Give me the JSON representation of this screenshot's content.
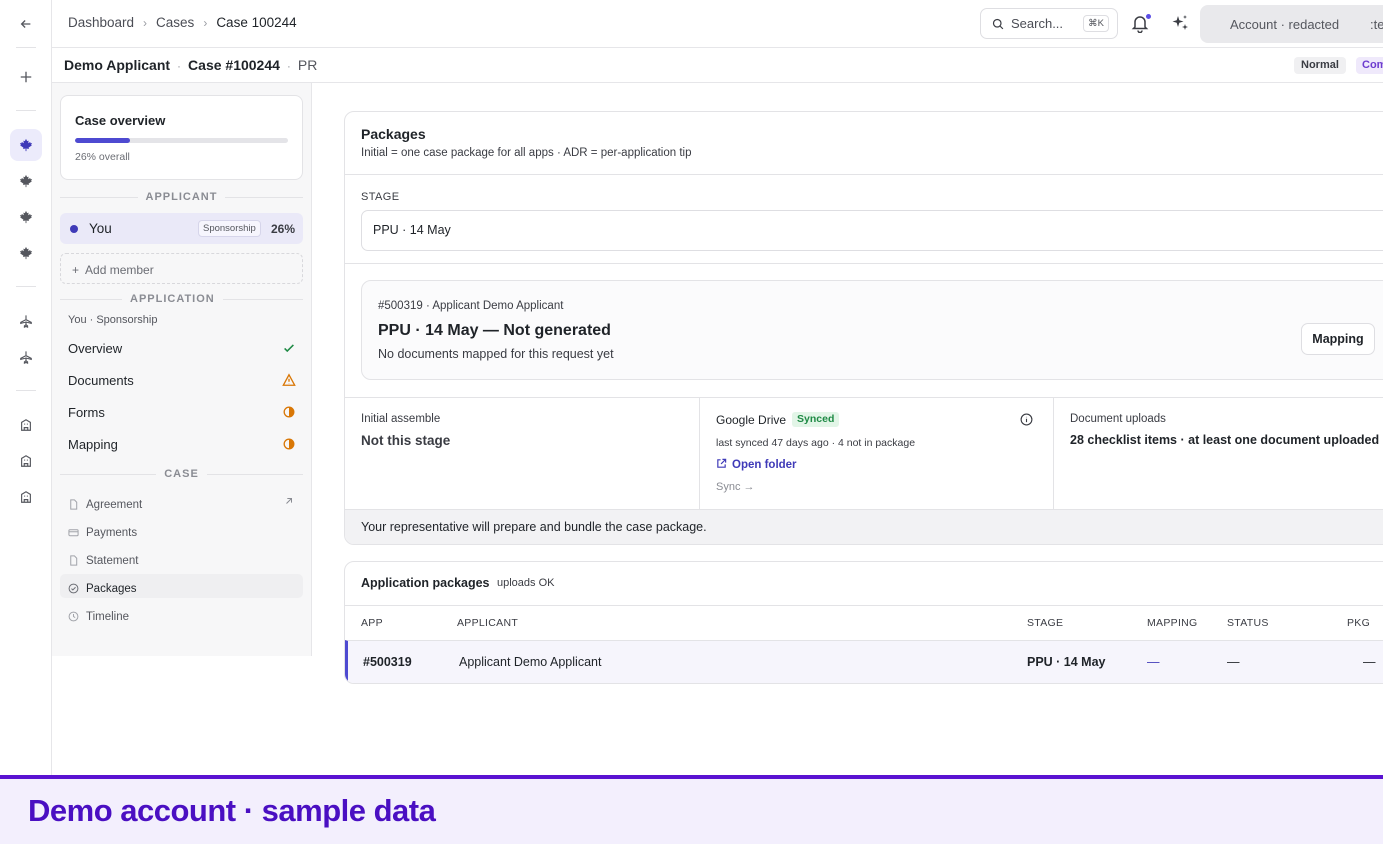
{
  "colors": {
    "accent": "#4e4ad1",
    "banner": "#5a12d1",
    "synced_bg": "#e2f5e7",
    "warning": "#d97706"
  },
  "breadcrumbs": [
    "Dashboard",
    "Cases",
    "Case 100244"
  ],
  "search": {
    "label": "Search...",
    "shortcut": "⌘K"
  },
  "account": {
    "label": "Account · redacted",
    "overflow": ":te"
  },
  "case_header": {
    "applicant": "Demo Applicant",
    "case_no": "Case #100244",
    "program": "PR",
    "priority": "Normal",
    "tag": "Com"
  },
  "rail": {
    "icons": [
      "back-arrow-icon",
      "plus-icon",
      "maple-leaf-icon",
      "maple-leaf-icon",
      "maple-leaf-icon",
      "maple-leaf-icon",
      "plane-icon",
      "plane-icon",
      "building-icon",
      "building-icon",
      "building-icon"
    ]
  },
  "sidebar": {
    "overview": {
      "title": "Case overview",
      "progress": 0.26,
      "progress_label": "26% overall"
    },
    "applicant_heading": "APPLICANT",
    "applicant": {
      "name": "You",
      "tag": "Sponsorship",
      "pct": "26%"
    },
    "add_member": "Add member",
    "application_heading": "APPLICATION",
    "application_sub": "You · Sponsorship",
    "application_items": [
      {
        "label": "Overview",
        "status": "complete"
      },
      {
        "label": "Documents",
        "status": "warning"
      },
      {
        "label": "Forms",
        "status": "partial"
      },
      {
        "label": "Mapping",
        "status": "partial"
      }
    ],
    "case_heading": "CASE",
    "case_items": [
      {
        "label": "Agreement",
        "icon": "document-icon"
      },
      {
        "label": "Payments",
        "icon": "card-icon"
      },
      {
        "label": "Statement",
        "icon": "document-icon"
      },
      {
        "label": "Packages",
        "icon": "check-circle-icon"
      },
      {
        "label": "Timeline",
        "icon": "clock-icon"
      }
    ]
  },
  "packages": {
    "title": "Packages",
    "subtitle": "Initial = one case package for all apps · ADR = per-application tip",
    "stage_label": "STAGE",
    "stage_value": "PPU · 14 May",
    "gen": {
      "id_line": "#500319 · Applicant Demo Applicant",
      "title": "PPU · 14 May — Not generated",
      "desc": "No documents mapped for this request yet",
      "button": "Mapping"
    },
    "initial": {
      "label": "Initial assemble",
      "value": "Not this stage"
    },
    "drive": {
      "label": "Google Drive",
      "status": "Synced",
      "meta": "last synced 47 days ago · 4 not in package",
      "open": "Open folder",
      "sync": "Sync →"
    },
    "uploads": {
      "label": "Document uploads",
      "value": "28 checklist items · at least one document uploaded"
    },
    "note": "Your representative will prepare and bundle the case package."
  },
  "app_packages": {
    "title": "Application packages",
    "badge": "uploads OK",
    "headers": [
      "APP",
      "APPLICANT",
      "STAGE",
      "MAPPING",
      "STATUS",
      "PKG"
    ],
    "rows": [
      {
        "app": "#500319",
        "applicant": "Applicant Demo Applicant",
        "stage": "PPU · 14 May",
        "mapping": "—",
        "status": "—",
        "pkg": "—"
      }
    ]
  },
  "banner": "Demo account · sample data"
}
